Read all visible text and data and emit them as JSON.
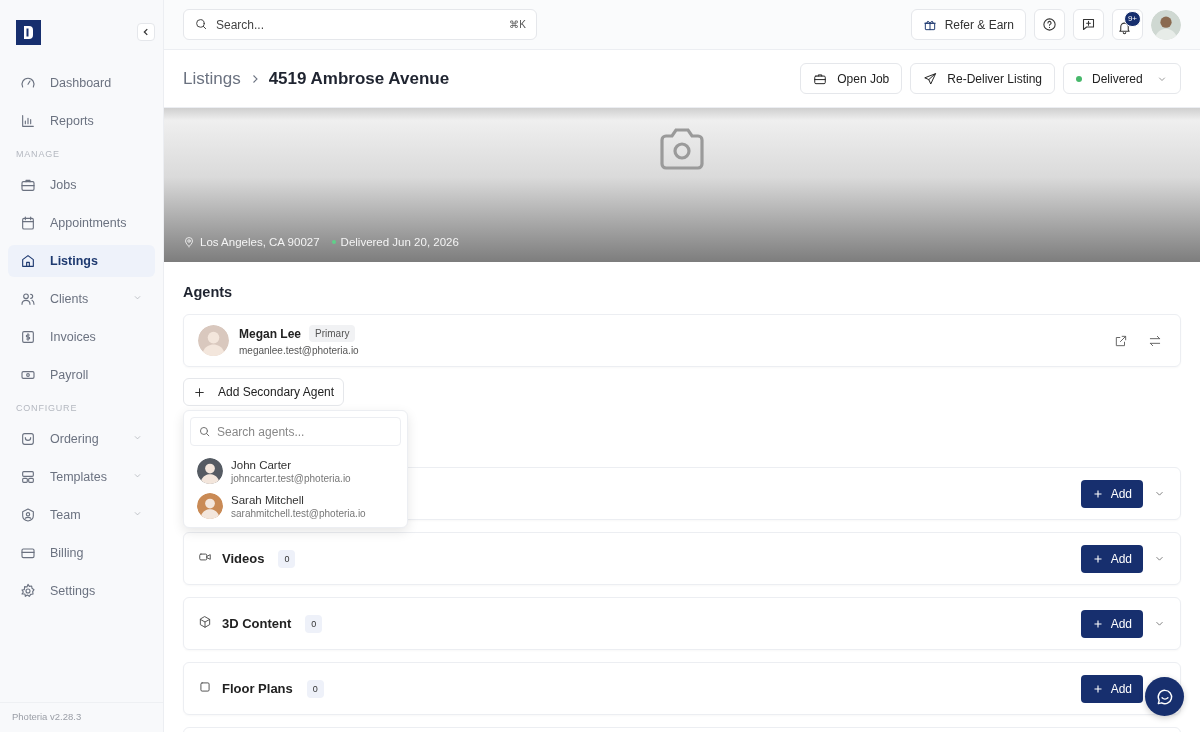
{
  "sidebar": {
    "groups": [
      {
        "items": [
          {
            "label": "Dashboard",
            "selected": false,
            "expandable": false
          },
          {
            "label": "Reports",
            "selected": false,
            "expandable": false
          }
        ]
      },
      {
        "heading": "MANAGE",
        "items": [
          {
            "label": "Jobs",
            "selected": false,
            "expandable": false
          },
          {
            "label": "Appointments",
            "selected": false,
            "expandable": false
          },
          {
            "label": "Listings",
            "selected": true,
            "expandable": false
          },
          {
            "label": "Clients",
            "selected": false,
            "expandable": true
          },
          {
            "label": "Invoices",
            "selected": false,
            "expandable": false
          },
          {
            "label": "Payroll",
            "selected": false,
            "expandable": false
          }
        ]
      },
      {
        "heading": "CONFIGURE",
        "items": [
          {
            "label": "Ordering",
            "selected": false,
            "expandable": true
          },
          {
            "label": "Templates",
            "selected": false,
            "expandable": true
          },
          {
            "label": "Team",
            "selected": false,
            "expandable": true
          },
          {
            "label": "Billing",
            "selected": false,
            "expandable": false
          },
          {
            "label": "Settings",
            "selected": false,
            "expandable": false
          }
        ]
      }
    ],
    "version": "Photeria v2.28.3"
  },
  "topbar": {
    "search": {
      "placeholder": "Search...",
      "shortcut": "⌘K"
    },
    "refer_button": "Refer & Earn",
    "notifications_badge": "9+"
  },
  "header": {
    "breadcrumb": [
      "Listings",
      "4519 Ambrose Avenue"
    ],
    "buttons": [
      "Open Job",
      "Re-Deliver Listing"
    ],
    "status": "Delivered"
  },
  "hero": {
    "location": "Los Angeles, CA 90027",
    "delivery": "Delivered Jun 20, 2026"
  },
  "agents": {
    "heading": "Agents",
    "primary": {
      "name": "Megan Lee",
      "badge": "Primary",
      "email": "meganlee.test@photeria.io"
    },
    "add_button": "Add Secondary Agent",
    "dropdown": {
      "placeholder": "Search agents...",
      "options": [
        {
          "name": "John Carter",
          "email": "johncarter.test@photeria.io",
          "selected": false
        },
        {
          "name": "Sarah Mitchell",
          "email": "sarahmitchell.test@photeria.io",
          "selected": false
        }
      ]
    }
  },
  "media": {
    "sections": [
      {
        "add_button": "Add"
      },
      {
        "label": "Videos",
        "count": "0",
        "add_button": "Add"
      },
      {
        "label": "3D Content",
        "count": "0",
        "add_button": "Add"
      },
      {
        "label": "Floor Plans",
        "count": "0",
        "add_button": "Add"
      }
    ]
  }
}
